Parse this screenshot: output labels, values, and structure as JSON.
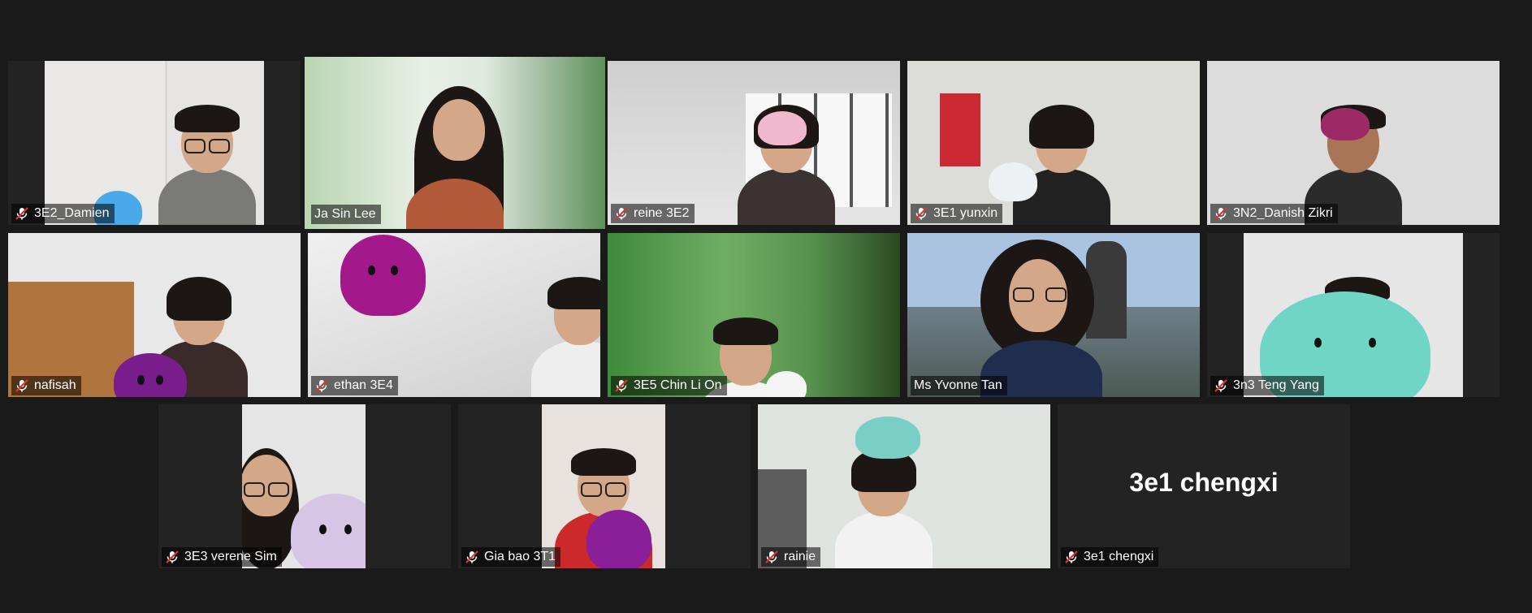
{
  "participants": [
    {
      "name": "3E2_Damien",
      "muted": true
    },
    {
      "name": "Ja Sin Lee",
      "muted": false,
      "speaking": true
    },
    {
      "name": "reine 3E2",
      "muted": true
    },
    {
      "name": "3E1 yunxin",
      "muted": true
    },
    {
      "name": "3N2_Danish Zikri",
      "muted": true
    },
    {
      "name": "nafisah",
      "muted": true
    },
    {
      "name": "ethan 3E4",
      "muted": true
    },
    {
      "name": "3E5 Chin Li On",
      "muted": true
    },
    {
      "name": "Ms Yvonne Tan",
      "muted": false
    },
    {
      "name": "3n3 Teng Yang",
      "muted": true
    },
    {
      "name": "3E3 verene Sim",
      "muted": true
    },
    {
      "name": "Gia bao 3T1",
      "muted": true
    },
    {
      "name": "rainie",
      "muted": true
    },
    {
      "name": "3e1 chengxi",
      "muted": true,
      "video_off": true
    }
  ],
  "colors": {
    "background": "#1a1a1a",
    "tile_background": "#232323",
    "active_speaker_border": "#d7e86a",
    "muted_icon": "#e0332b"
  },
  "icons": {
    "muted": "muted-microphone-icon"
  }
}
